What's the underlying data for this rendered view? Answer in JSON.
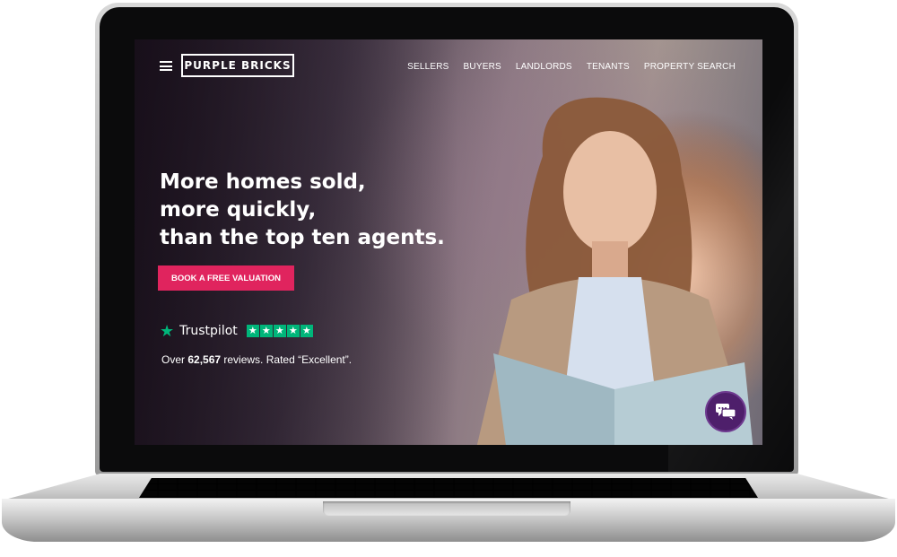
{
  "header": {
    "logo_text": "PURPLE BRICKS",
    "nav": [
      "SELLERS",
      "BUYERS",
      "LANDLORDS",
      "TENANTS",
      "PROPERTY SEARCH"
    ]
  },
  "hero": {
    "headline": [
      "More homes sold,",
      "more quickly,",
      "than the top ten agents."
    ],
    "cta_label": "BOOK A FREE VALUATION"
  },
  "trustpilot": {
    "brand": "Trustpilot",
    "rating_stars": 5,
    "reviews_prefix": "Over ",
    "reviews_count": "62,567",
    "reviews_suffix": " reviews. Rated “Excellent”."
  },
  "icons": {
    "menu": "hamburger-menu-icon",
    "chat": "chat-bubbles-icon",
    "trustpilot_star": "star-icon"
  },
  "colors": {
    "cta": "#e0245e",
    "trustpilot_green": "#00b67a",
    "chat_purple": "#4e1f6b"
  }
}
